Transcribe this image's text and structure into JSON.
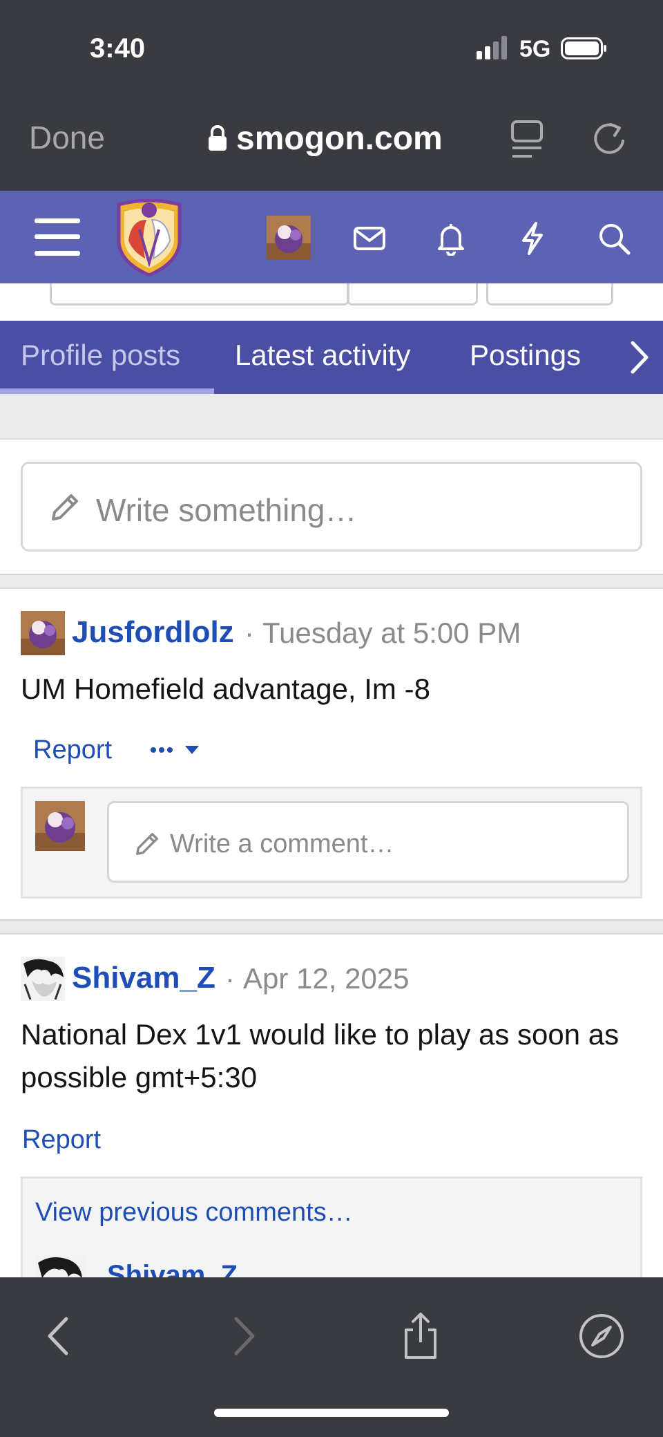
{
  "status": {
    "time": "3:40",
    "network": "5G"
  },
  "safari": {
    "done_label": "Done",
    "url": "smogon.com"
  },
  "tabs": [
    {
      "label": "Profile posts",
      "active": true
    },
    {
      "label": "Latest activity",
      "active": false
    },
    {
      "label": "Postings",
      "active": false
    }
  ],
  "composer": {
    "placeholder": "Write something…"
  },
  "posts": [
    {
      "user": "Jusfordlolz",
      "separator": "·",
      "time": "Tuesday at 5:00 PM",
      "body": "UM Homefield advantage, Im -8",
      "report_label": "Report",
      "comment_placeholder": "Write a comment…"
    },
    {
      "user": "Shivam_Z",
      "separator": "·",
      "time": "Apr 12, 2025",
      "body": "National Dex 1v1 would like to play as soon as possible gmt+5:30",
      "report_label": "Report",
      "view_previous": "View previous comments…",
      "nested_user": "Shivam_Z"
    }
  ],
  "colors": {
    "header": "#5d62b2",
    "tabs": "#4a4fa4",
    "link": "#1d4db5",
    "chrome": "#3a3b40"
  },
  "icons": [
    "menu-icon",
    "mail-icon",
    "bell-icon",
    "bolt-icon",
    "search-icon",
    "pencil-icon",
    "chevron-right-icon",
    "back-icon",
    "forward-icon",
    "share-icon",
    "compass-icon"
  ]
}
